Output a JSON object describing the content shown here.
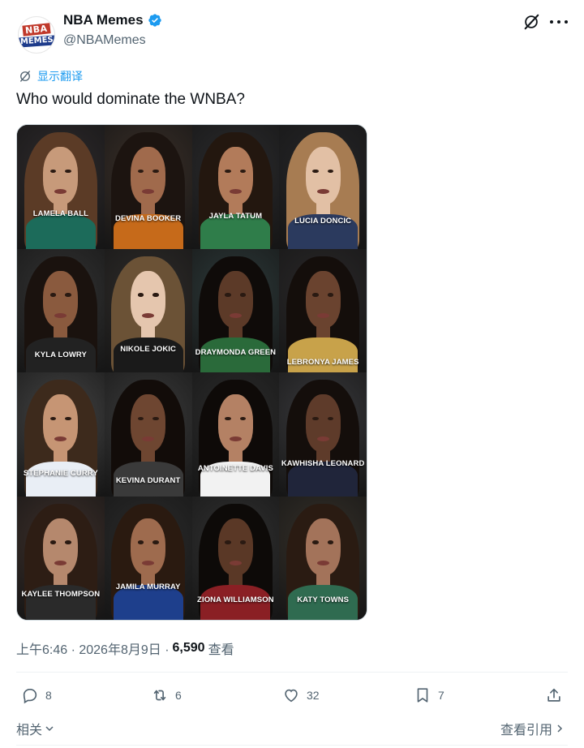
{
  "tweet": {
    "display_name": "NBA Memes",
    "handle": "@NBAMemes",
    "avatar_lines": [
      "NBA",
      "MEMES"
    ],
    "translate_label": "显示翻译",
    "text": "Who would dominate the WNBA?",
    "timestamp": "上午6:46 · 2026年8月9日 ·",
    "views_count": "6,590",
    "views_label": "查看"
  },
  "image": {
    "labels": [
      "LAMELA BALL",
      "DEVINA BOOKER",
      "JAYLA TATUM",
      "LUCIA DONCIC",
      "KYLA LOWRY",
      "NIKOLE JOKIC",
      "DRAYMONDA GREEN",
      "LEBRONYA JAMES",
      "STEPHANIE CURRY",
      "KEVINA DURANT",
      "ANTOINETTE DAVIS",
      "KAWHISHA LEONARD",
      "KAYLEE THOMPSON",
      "JAMILA MURRAY",
      "ZIONA WILLIAMSON",
      "KATY TOWNS"
    ]
  },
  "actions": {
    "replies": "8",
    "reposts": "6",
    "likes": "32",
    "bookmarks": "7"
  },
  "footer": {
    "related_label": "相关",
    "quotes_label": "查看引用"
  },
  "colors": {
    "accent": "#1d9bf0",
    "text_primary": "#0f1419",
    "text_secondary": "#536471",
    "divider": "#eff3f4"
  }
}
